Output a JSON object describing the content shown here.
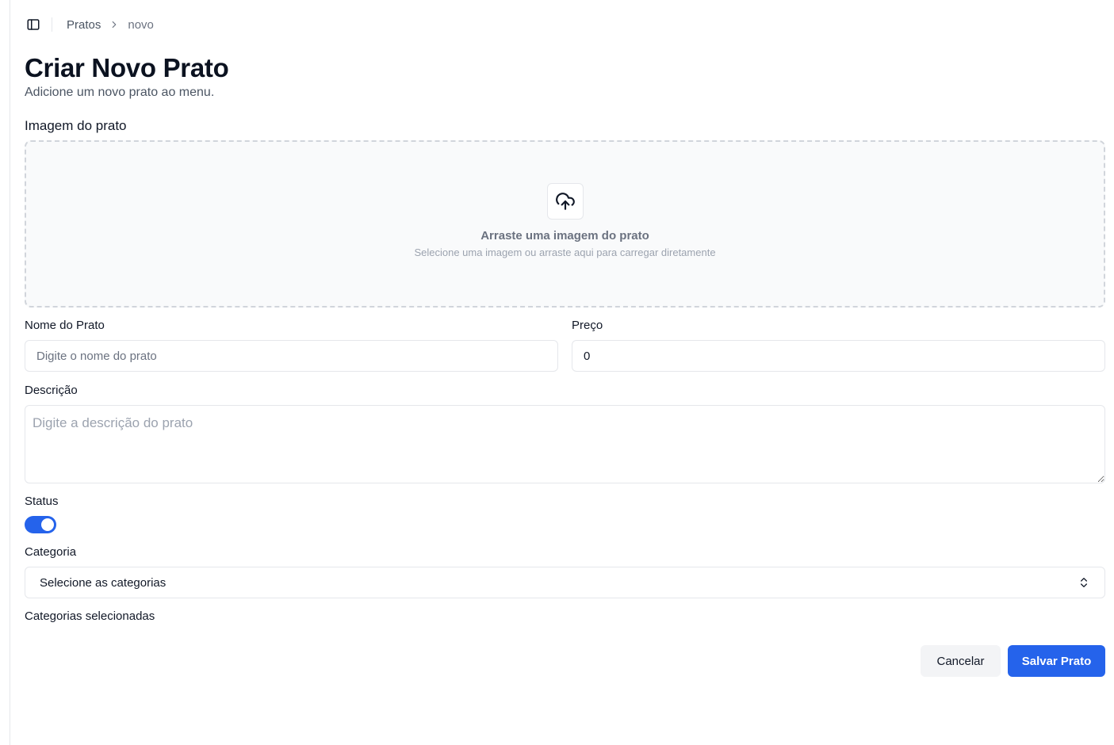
{
  "breadcrumb": {
    "parent": "Pratos",
    "current": "novo"
  },
  "header": {
    "title": "Criar Novo Prato",
    "subtitle": "Adicione um novo prato ao menu."
  },
  "image_upload": {
    "label": "Imagem do prato",
    "title": "Arraste uma imagem do prato",
    "subtitle": "Selecione uma imagem ou arraste aqui para carregar diretamente"
  },
  "form": {
    "name": {
      "label": "Nome do Prato",
      "placeholder": "Digite o nome do prato",
      "value": ""
    },
    "price": {
      "label": "Preço",
      "value": "0"
    },
    "description": {
      "label": "Descrição",
      "placeholder": "Digite a descrição do prato"
    },
    "status": {
      "label": "Status",
      "enabled": true
    },
    "category": {
      "label": "Categoria",
      "selected": "Selecione as categorias"
    },
    "selected_categories_label": "Categorias selecionadas"
  },
  "actions": {
    "cancel": "Cancelar",
    "save": "Salvar Prato"
  },
  "colors": {
    "accent": "#2563eb",
    "border": "#e5e7eb",
    "dropzone_bg": "#f9fafb"
  },
  "icons": [
    "sidebar-toggle-icon",
    "chevron-right-icon",
    "cloud-upload-icon",
    "chevron-up-down-icon"
  ]
}
